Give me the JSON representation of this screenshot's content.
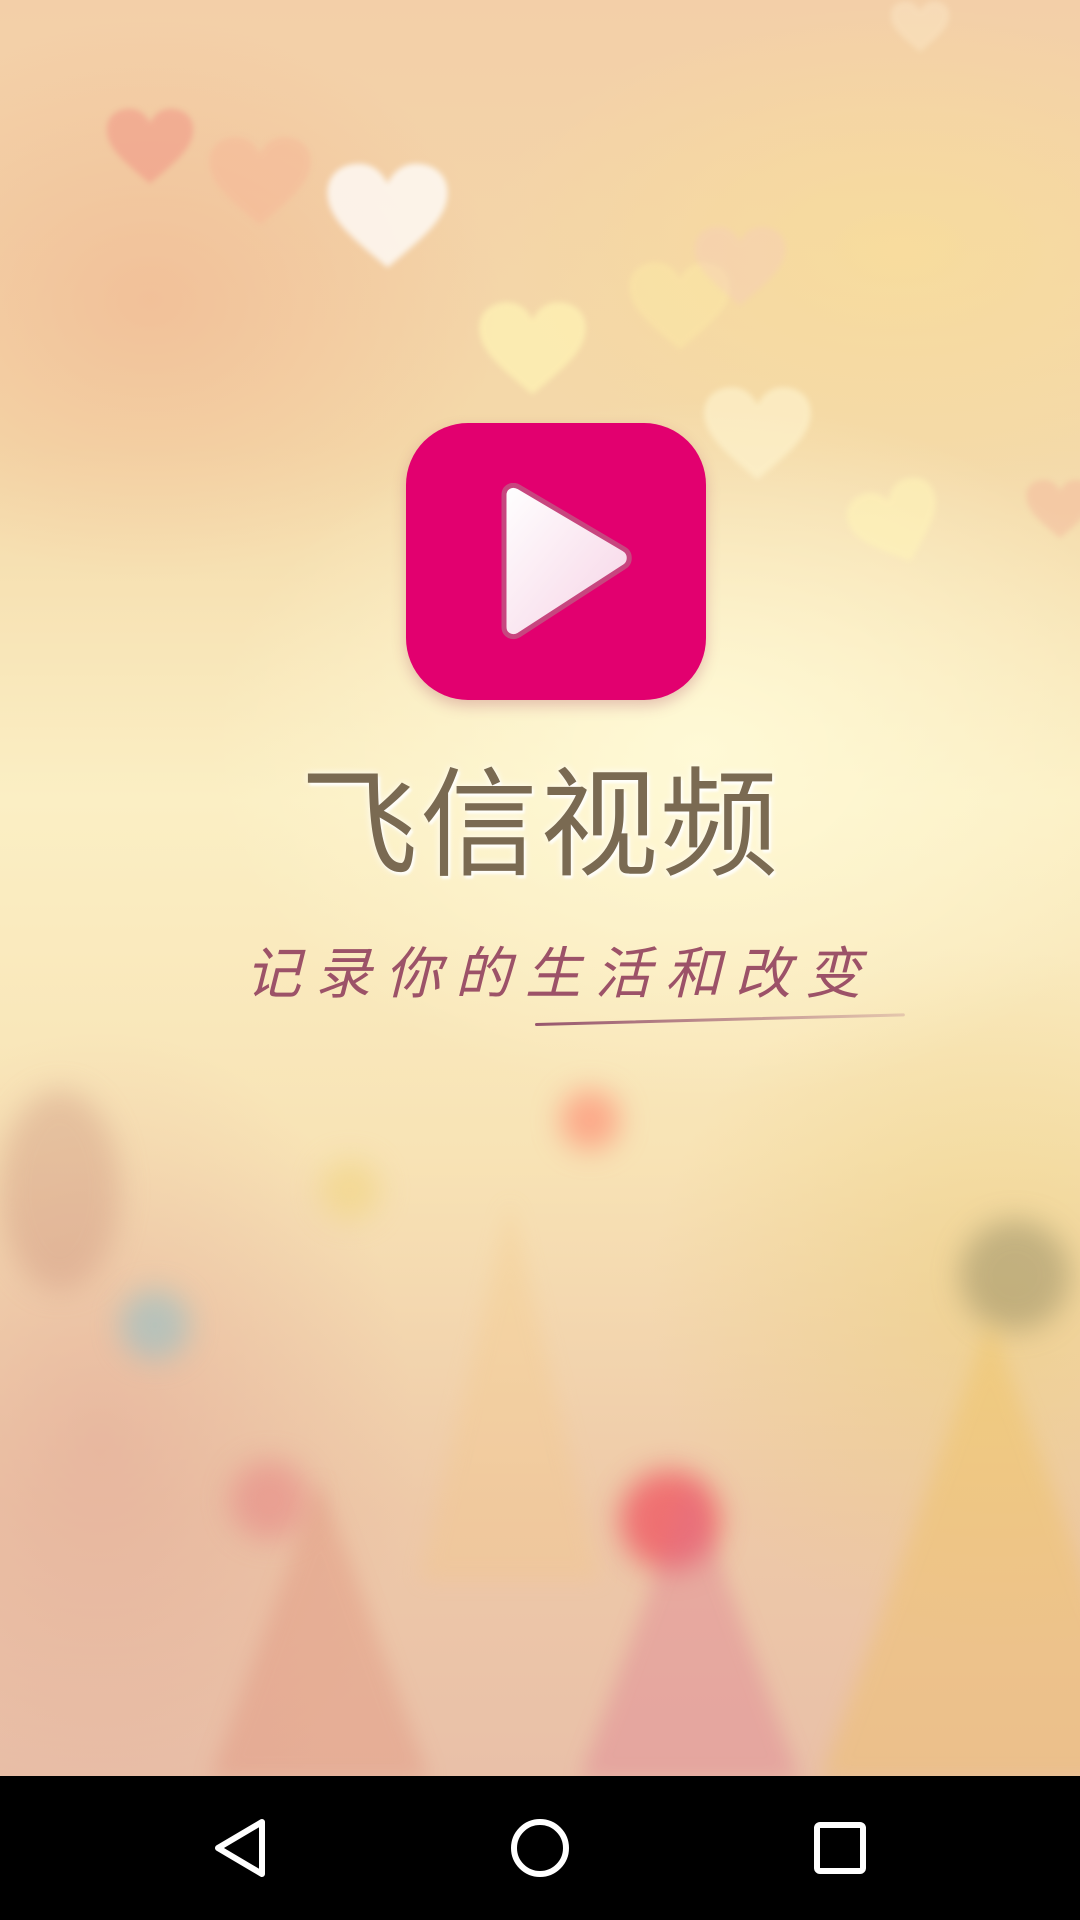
{
  "app": {
    "title": "飞信视频",
    "tagline": "记录你的生活和改变"
  },
  "logo": {
    "icon": "play-icon",
    "background_color": "#e2006f"
  },
  "navigation_bar": {
    "back": {
      "icon": "back-triangle-icon"
    },
    "home": {
      "icon": "home-circle-icon"
    },
    "recents": {
      "icon": "recents-square-icon"
    }
  }
}
